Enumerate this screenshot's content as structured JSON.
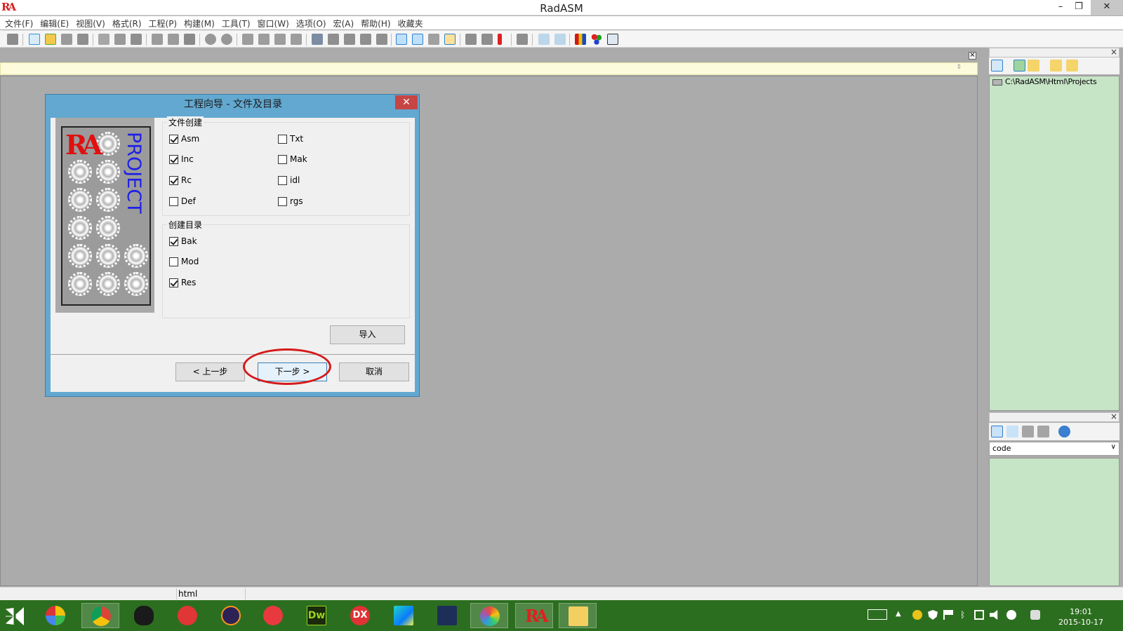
{
  "app": {
    "logo": "RA",
    "title": "RadASM"
  },
  "window_controls": {
    "minimize": "–",
    "restore": "❐",
    "close": "✕"
  },
  "menu": [
    "文件(F)",
    "编辑(E)",
    "视图(V)",
    "格式(R)",
    "工程(P)",
    "构建(M)",
    "工具(T)",
    "窗口(W)",
    "选项(O)",
    "宏(A)",
    "帮助(H)",
    "收藏夹"
  ],
  "toolbar_icons": [
    "print-icon",
    "new-file-icon",
    "open-file-icon",
    "save-icon",
    "save-all-icon",
    "cut-icon",
    "copy-icon",
    "paste-icon",
    "undo-icon",
    "redo-icon",
    "delete-icon",
    "find-icon",
    "replace-icon",
    "bookmark-icon",
    "bookmark-next-icon",
    "bookmark-prev-icon",
    "bookmark-clear-icon",
    "indent-icon",
    "outdent-icon",
    "comment-icon",
    "uncomment-icon",
    "align-icon",
    "project-view-icon",
    "file-view-icon",
    "tools-icon",
    "properties-icon",
    "import-icon",
    "export-icon",
    "warning-icon",
    "build-icon",
    "output-icon",
    "output-alt-icon",
    "color-bars-icon",
    "palette-icon",
    "search-window-icon"
  ],
  "project_panel": {
    "path": "C:\\RadASM\\Html\\Projects"
  },
  "properties_panel": {
    "select_value": "code"
  },
  "status": {
    "field1": "html"
  },
  "dialog": {
    "title": "工程向导 - 文件及目录",
    "close": "✕",
    "image_logo": "RA",
    "image_text": "PROJECT",
    "file_group": {
      "label": "文件创建",
      "items": [
        {
          "label": "Asm",
          "checked": true
        },
        {
          "label": "Inc",
          "checked": true
        },
        {
          "label": "Rc",
          "checked": true
        },
        {
          "label": "Def",
          "checked": false
        },
        {
          "label": "Txt",
          "checked": false
        },
        {
          "label": "Mak",
          "checked": false
        },
        {
          "label": "idl",
          "checked": false
        },
        {
          "label": "rgs",
          "checked": false
        }
      ]
    },
    "dir_group": {
      "label": "创建目录",
      "items": [
        {
          "label": "Bak",
          "checked": true
        },
        {
          "label": "Mod",
          "checked": false
        },
        {
          "label": "Res",
          "checked": true
        }
      ]
    },
    "import_label": "导入",
    "back_label": "< 上一步",
    "next_label": "下一步 >",
    "cancel_label": "取消"
  },
  "taskbar": {
    "apps": [
      "windows-start-icon",
      "photos-app-icon",
      "chrome-icon",
      "qq-icon",
      "netease-music-icon",
      "eclipse-icon",
      "browser-icon",
      "dreamweaver-icon",
      "dx-icon",
      "webstorm-icon",
      "scrivener-icon",
      "paint-icon",
      "radasm-icon",
      "file-explorer-icon"
    ],
    "dreamweaver_label": "Dw",
    "dx_label": "DX",
    "clock_time": "19:01",
    "clock_date": "2015-10-17"
  }
}
